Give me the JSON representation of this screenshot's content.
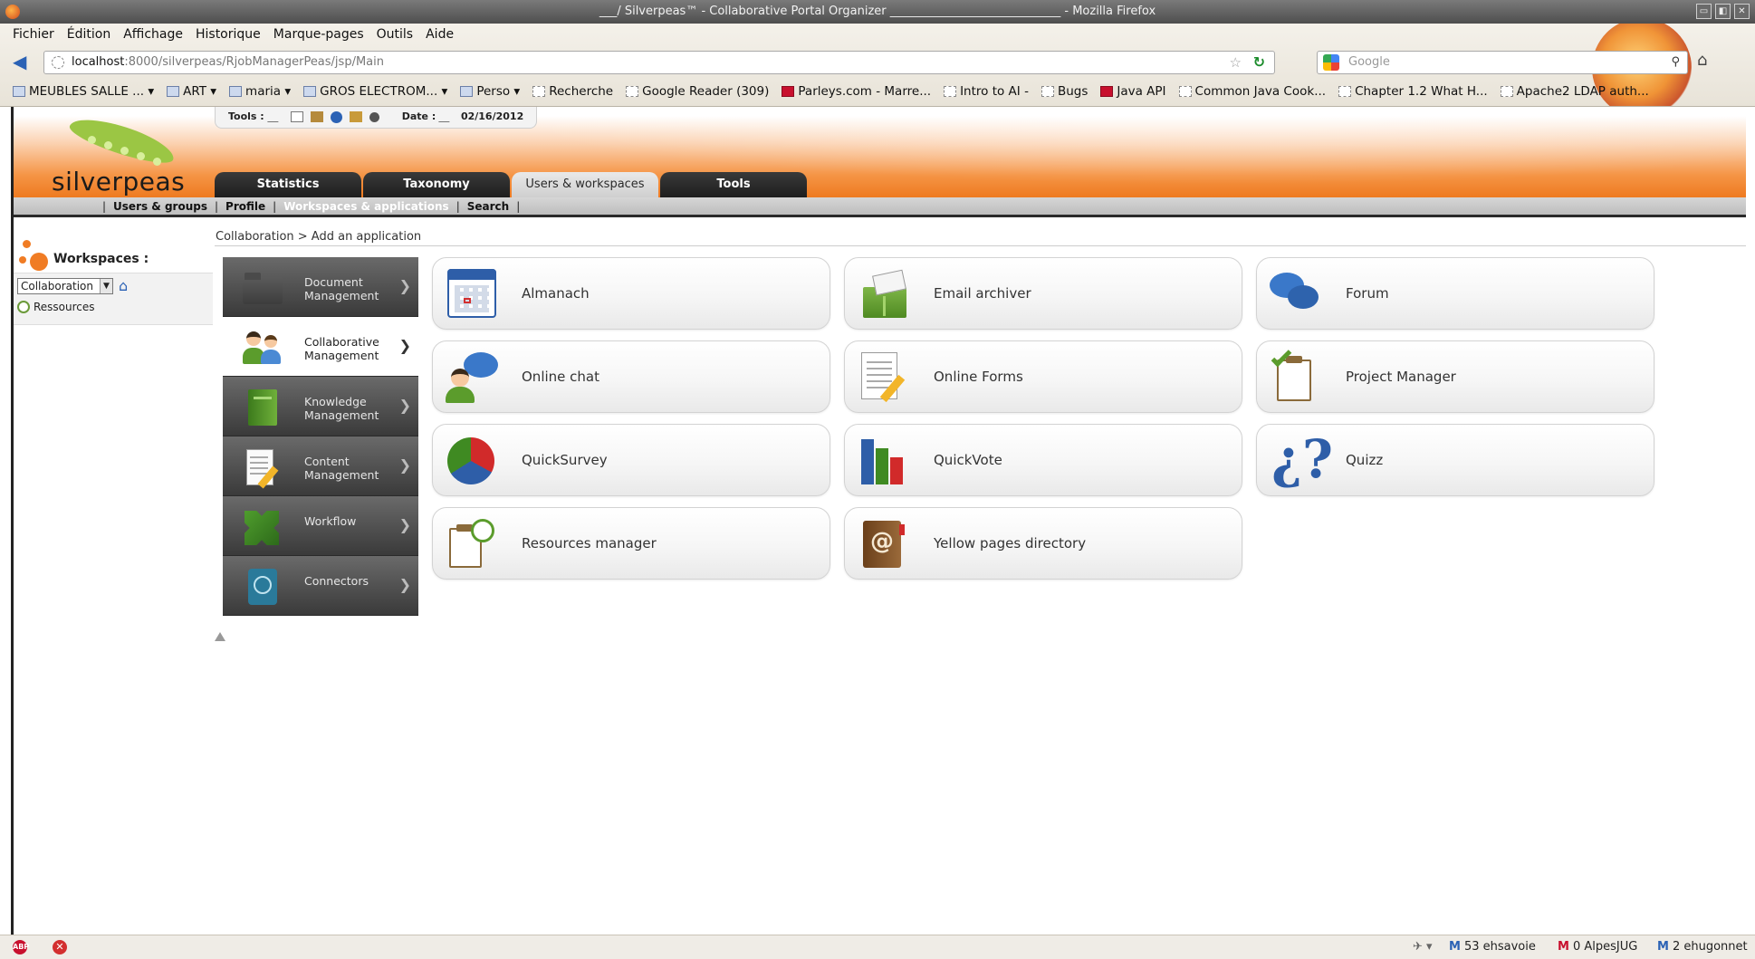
{
  "window": {
    "title": "___/ Silverpeas™ - Collaborative Portal Organizer _____________________________ - Mozilla Firefox",
    "buttons": [
      "▭",
      "◧",
      "✕"
    ]
  },
  "browser": {
    "menu": [
      "Fichier",
      "Édition",
      "Affichage",
      "Historique",
      "Marque-pages",
      "Outils",
      "Aide"
    ],
    "url_host": "localhost",
    "url_rest": ":8000/silverpeas/RjobManagerPeas/jsp/Main",
    "search_placeholder": "Google",
    "bookmarks": [
      {
        "label": "MEUBLES SALLE ... ▾",
        "icon": "folder-icon"
      },
      {
        "label": "ART ▾",
        "icon": "folder-icon"
      },
      {
        "label": "maria ▾",
        "icon": "folder-icon"
      },
      {
        "label": "GROS ELECTROM... ▾",
        "icon": "folder-icon"
      },
      {
        "label": "Perso ▾",
        "icon": "folder-icon"
      },
      {
        "label": "Recherche",
        "icon": "page-icon"
      },
      {
        "label": "Google Reader (309)",
        "icon": "page-icon"
      },
      {
        "label": "Parleys.com - Marre...",
        "icon": "red-icon"
      },
      {
        "label": "Intro to AI -",
        "icon": "page-icon"
      },
      {
        "label": "Bugs",
        "icon": "page-icon"
      },
      {
        "label": "Java API",
        "icon": "red-icon"
      },
      {
        "label": "Common Java Cook...",
        "icon": "page-icon"
      },
      {
        "label": "Chapter 1.2 What H...",
        "icon": "page-icon"
      },
      {
        "label": "Apache2 LDAP auth...",
        "icon": "page-icon"
      }
    ]
  },
  "header": {
    "logo_text": "silverpeas",
    "tools_label": "Tools :",
    "date_label": "Date :",
    "date_value": "02/16/2012",
    "tabs": [
      {
        "label": "Statistics",
        "active": false
      },
      {
        "label": "Taxonomy",
        "active": false
      },
      {
        "label": "Users & workspaces",
        "active": true
      },
      {
        "label": "Tools",
        "active": false
      }
    ],
    "subnav": [
      {
        "label": "Users & groups",
        "active": false
      },
      {
        "label": "Profile",
        "active": false
      },
      {
        "label": "Workspaces & applications",
        "active": true
      },
      {
        "label": "Search",
        "active": false
      }
    ]
  },
  "sidebar": {
    "title": "Workspaces :",
    "selected_space": "Collaboration",
    "items": [
      {
        "label": "Ressources"
      }
    ]
  },
  "breadcrumb": "Collaboration > Add an application",
  "categories": [
    {
      "label": "Document Management",
      "icon": "folder-icon",
      "active": false
    },
    {
      "label": "Collaborative Management",
      "icon": "people-icon",
      "active": true
    },
    {
      "label": "Knowledge Management",
      "icon": "book-icon",
      "active": false
    },
    {
      "label": "Content Management",
      "icon": "document-pencil-icon",
      "active": false
    },
    {
      "label": "Workflow",
      "icon": "workflow-icon",
      "active": false
    },
    {
      "label": "Connectors",
      "icon": "disk-icon",
      "active": false
    }
  ],
  "applications": [
    {
      "label": "Almanach",
      "icon": "calendar-icon"
    },
    {
      "label": "Email archiver",
      "icon": "email-archive-icon"
    },
    {
      "label": "Forum",
      "icon": "speech-bubbles-icon"
    },
    {
      "label": "Online chat",
      "icon": "chat-user-icon"
    },
    {
      "label": "Online Forms",
      "icon": "form-icon"
    },
    {
      "label": "Project Manager",
      "icon": "clipboard-check-icon"
    },
    {
      "label": "QuickSurvey",
      "icon": "pie-chart-icon"
    },
    {
      "label": "QuickVote",
      "icon": "bar-chart-icon"
    },
    {
      "label": "Quizz",
      "icon": "question-icon"
    },
    {
      "label": "Resources manager",
      "icon": "clipboard-clock-icon"
    },
    {
      "label": "Yellow pages directory",
      "icon": "address-book-icon"
    }
  ],
  "statusbar": {
    "abp": "ABP",
    "mail": [
      {
        "label": "53 ehsavoie",
        "color": "blue"
      },
      {
        "label": "0 AlpesJUG",
        "color": "red"
      },
      {
        "label": "2 ehugonnet",
        "color": "blue"
      }
    ]
  },
  "colors": {
    "accent": "#ee7a20",
    "tab_dark": "#1e1e1e",
    "category_dark": "#3c3c3c"
  }
}
